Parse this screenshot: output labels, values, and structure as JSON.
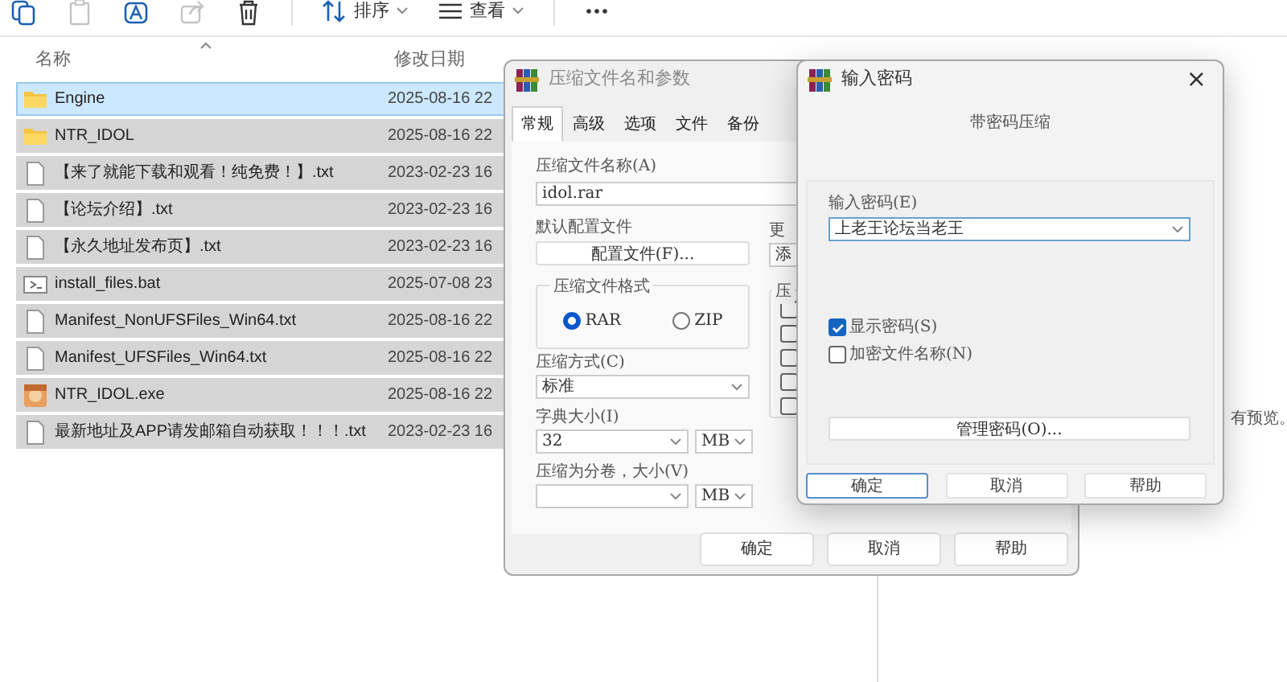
{
  "toolbar": {
    "items": [
      {
        "kind": "copy",
        "disabled": false
      },
      {
        "kind": "paste",
        "disabled": true
      },
      {
        "kind": "rename",
        "disabled": false
      },
      {
        "kind": "share",
        "disabled": true
      },
      {
        "kind": "delete",
        "disabled": false
      },
      {
        "kind": "sort",
        "label": "排序",
        "disabled": false
      },
      {
        "kind": "view",
        "label": "查看",
        "disabled": false
      },
      {
        "kind": "more",
        "disabled": false
      }
    ]
  },
  "file_list": {
    "columns": [
      {
        "label": "名称",
        "sorted": true
      },
      {
        "label": "修改日期",
        "sorted": false
      }
    ],
    "rows": [
      {
        "kind": "folder",
        "name": "Engine",
        "modified": "2025-08-16 22",
        "selected": true,
        "focused": true
      },
      {
        "kind": "folder",
        "name": "NTR_IDOL",
        "modified": "2025-08-16 22",
        "selected": true,
        "focused": false
      },
      {
        "kind": "text",
        "name": "【来了就能下载和观看！纯免费！】.txt",
        "modified": "2023-02-23 16",
        "selected": true,
        "focused": false
      },
      {
        "kind": "text",
        "name": "【论坛介绍】.txt",
        "modified": "2023-02-23 16",
        "selected": true,
        "focused": false
      },
      {
        "kind": "text",
        "name": "【永久地址发布页】.txt",
        "modified": "2023-02-23 16",
        "selected": true,
        "focused": false
      },
      {
        "kind": "script",
        "name": "install_files.bat",
        "modified": "2025-07-08 23",
        "selected": true,
        "focused": false
      },
      {
        "kind": "text",
        "name": "Manifest_NonUFSFiles_Win64.txt",
        "modified": "2025-08-16 22",
        "selected": true,
        "focused": false
      },
      {
        "kind": "text",
        "name": "Manifest_UFSFiles_Win64.txt",
        "modified": "2025-08-16 22",
        "selected": true,
        "focused": false
      },
      {
        "kind": "app",
        "name": "NTR_IDOL.exe",
        "modified": "2025-08-16 22",
        "selected": true,
        "focused": false
      },
      {
        "kind": "text",
        "name": "最新地址及APP请发邮箱自动获取！！！.txt",
        "modified": "2023-02-23 16",
        "selected": true,
        "focused": false
      }
    ]
  },
  "preview_note": "有预览。",
  "archive_dialog": {
    "title": "压缩文件名和参数",
    "tabs": [
      {
        "label": "常规",
        "selected": true
      },
      {
        "label": "高级",
        "selected": false
      },
      {
        "label": "选项",
        "selected": false
      },
      {
        "label": "文件",
        "selected": false
      },
      {
        "label": "备份",
        "selected": false
      }
    ],
    "archive_name_label": "压缩文件名称(A)",
    "archive_name": "idol.rar",
    "profile_label": "默认配置文件",
    "profile_button": "配置文件(F)...",
    "update_label": "更",
    "update_value": "添",
    "format_group": "压缩文件格式",
    "formats": [
      {
        "label": "RAR",
        "selected": true
      },
      {
        "label": "ZIP",
        "selected": false
      }
    ],
    "options_group": "压",
    "option_boxes": [
      {
        "checked": false
      },
      {
        "checked": false
      },
      {
        "checked": false
      },
      {
        "checked": false
      },
      {
        "checked": false
      }
    ],
    "method_label": "压缩方式(C)",
    "method": "标准",
    "dictionary_label": "字典大小(I)",
    "dictionary": "32",
    "dictionary_unit": "MB",
    "volume_label": "压缩为分卷，大小(V)",
    "volume_unit": "MB",
    "buttons": [
      "确定",
      "取消",
      "帮助"
    ]
  },
  "password_dialog": {
    "title": "输入密码",
    "close": "×",
    "heading": "带密码压缩",
    "password_label": "输入密码(E)",
    "password": "上老王论坛当老王",
    "options": [
      {
        "label": "显示密码(S)",
        "checked": true
      },
      {
        "label": "加密文件名称(N)",
        "checked": false
      }
    ],
    "manage_button": "管理密码(O)...",
    "buttons": [
      {
        "label": "确定",
        "default": true
      },
      {
        "label": "取消",
        "default": false
      },
      {
        "label": "帮助",
        "default": false
      }
    ]
  }
}
